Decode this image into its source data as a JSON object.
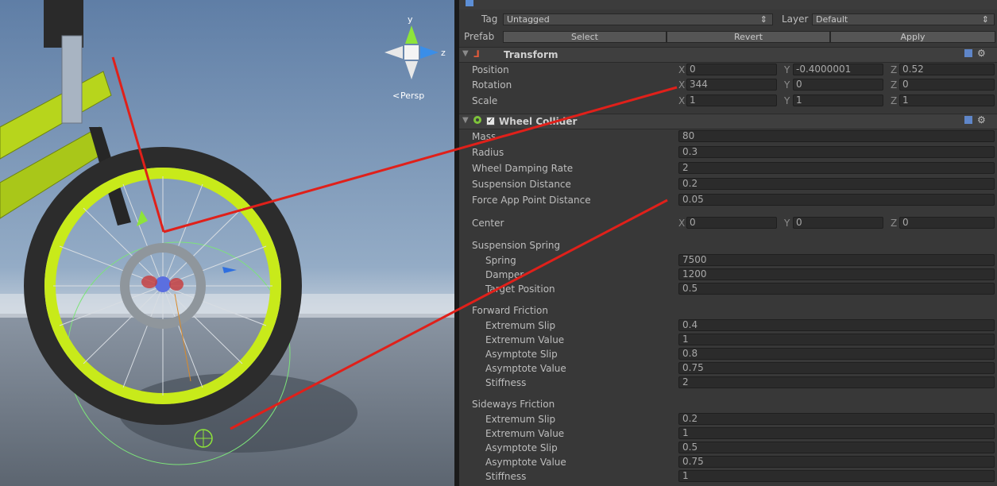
{
  "header": {
    "tag_label": "Tag",
    "tag_value": "Untagged",
    "layer_label": "Layer",
    "layer_value": "Default",
    "prefab_label": "Prefab",
    "select_label": "Select",
    "revert_label": "Revert",
    "apply_label": "Apply"
  },
  "scene": {
    "gizmo_y": "y",
    "gizmo_z": "z",
    "persp_label": "Persp"
  },
  "transform": {
    "title": "Transform",
    "position_label": "Position",
    "rotation_label": "Rotation",
    "scale_label": "Scale",
    "axis_x": "X",
    "axis_y": "Y",
    "axis_z": "Z",
    "position": {
      "x": "0",
      "y": "-0.4000001",
      "z": "0.52"
    },
    "rotation": {
      "x": "344",
      "y": "0",
      "z": "0"
    },
    "scale": {
      "x": "1",
      "y": "1",
      "z": "1"
    }
  },
  "wheel": {
    "title": "Wheel Collider",
    "mass_label": "Mass",
    "mass": "80",
    "radius_label": "Radius",
    "radius": "0.3",
    "damping_label": "Wheel Damping Rate",
    "damping": "2",
    "susp_dist_label": "Suspension Distance",
    "susp_dist": "0.2",
    "force_app_label": "Force App Point Distance",
    "force_app": "0.05",
    "center_label": "Center",
    "center": {
      "x": "0",
      "y": "0",
      "z": "0"
    },
    "spring_section": "Suspension Spring",
    "spring_label": "Spring",
    "spring": "7500",
    "damper_label": "Damper",
    "damper": "1200",
    "target_label": "Target Position",
    "target": "0.5",
    "forward_section": "Forward Friction",
    "sideways_section": "Sideways Friction",
    "ext_slip_label": "Extremum Slip",
    "ext_val_label": "Extremum Value",
    "asy_slip_label": "Asymptote Slip",
    "asy_val_label": "Asymptote Value",
    "stiff_label": "Stiffness",
    "forward": {
      "ext_slip": "0.4",
      "ext_val": "1",
      "asy_slip": "0.8",
      "asy_val": "0.75",
      "stiff": "2"
    },
    "sideways": {
      "ext_slip": "0.2",
      "ext_val": "1",
      "asy_slip": "0.5",
      "asy_val": "0.75",
      "stiff": "1"
    }
  },
  "colors": {
    "tire_green": "#c8ea1a",
    "annotation_red": "#e0201a",
    "sky": "#8fa9c5"
  }
}
